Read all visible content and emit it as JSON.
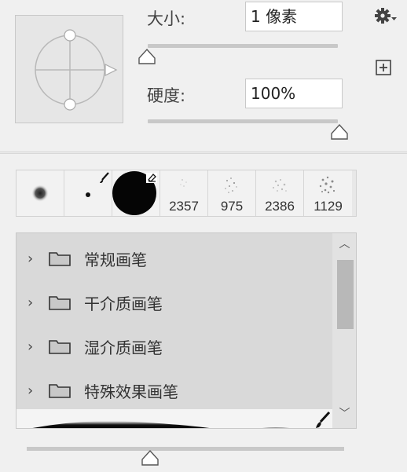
{
  "brush_settings": {
    "size_label": "大小:",
    "size_value": "1 像素",
    "hardness_label": "硬度:",
    "hardness_value": "100%",
    "size_slider_fraction": 0.0,
    "hardness_slider_fraction": 1.0,
    "settings_icon": "gear-icon",
    "new_preset_icon": "plus-square-icon"
  },
  "swatches": [
    {
      "kind": "soft-round",
      "count": ""
    },
    {
      "kind": "small-hard-round",
      "count": ""
    },
    {
      "kind": "large-hard-round",
      "count": ""
    },
    {
      "kind": "spatter",
      "count": "2357"
    },
    {
      "kind": "spatter",
      "count": "975"
    },
    {
      "kind": "spatter",
      "count": "2386"
    },
    {
      "kind": "spatter",
      "count": "1129"
    }
  ],
  "brush_folders": [
    {
      "label": "常规画笔"
    },
    {
      "label": "干介质画笔"
    },
    {
      "label": "湿介质画笔"
    },
    {
      "label": "特殊效果画笔"
    }
  ],
  "preview_slider_fraction": 0.39,
  "colors": {
    "panel_bg": "#f0f0f0",
    "list_bg": "#d9d9d9",
    "track": "#c8c8c8"
  }
}
